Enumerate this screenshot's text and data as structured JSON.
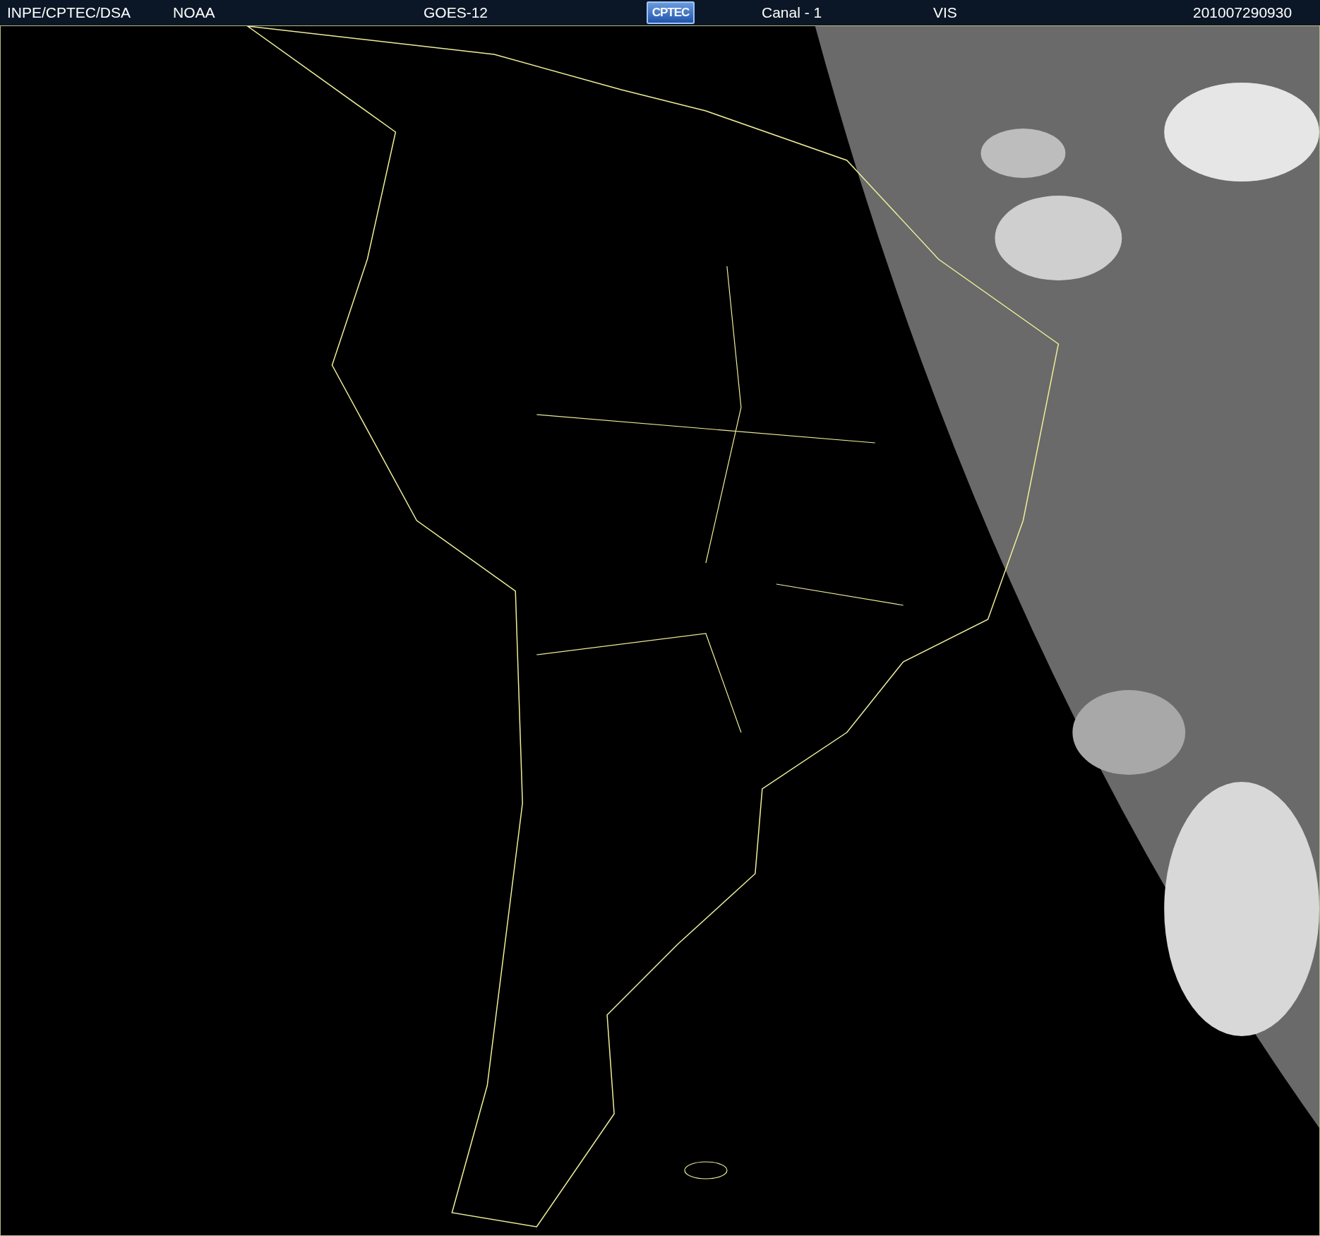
{
  "header": {
    "source": "INPE/CPTEC/DSA",
    "agency": "NOAA",
    "satellite": "GOES-12",
    "logo": "CPTEC",
    "channel": "Canal - 1",
    "band": "VIS",
    "timestamp": "201007290930"
  }
}
